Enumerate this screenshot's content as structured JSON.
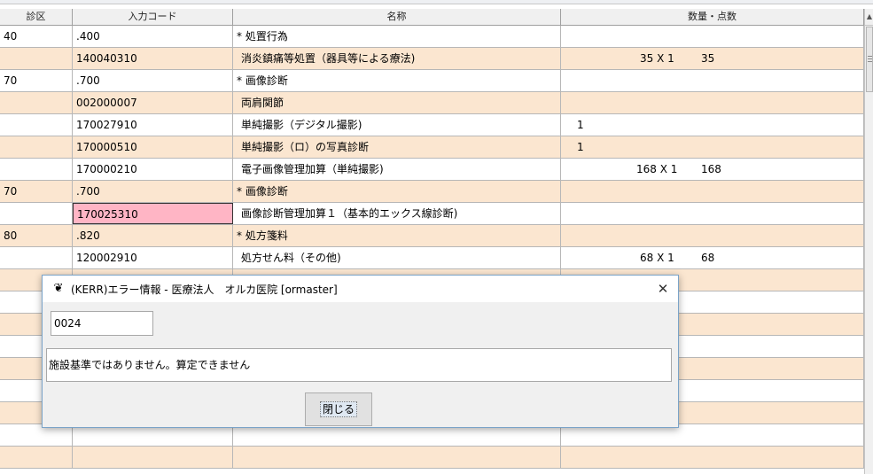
{
  "table": {
    "headers": [
      "診区",
      "入力コード",
      "名称",
      "数量・点数"
    ],
    "rows": [
      {
        "kubun": "40",
        "code": ".400",
        "name": "* 処置行為",
        "qty": "",
        "points": ""
      },
      {
        "kubun": "",
        "code": "140040310",
        "name": "消炎鎮痛等処置（器具等による療法)",
        "qty": "35 X 1",
        "points": "35"
      },
      {
        "kubun": "70",
        "code": ".700",
        "name": "* 画像診断",
        "qty": "",
        "points": ""
      },
      {
        "kubun": "",
        "code": "002000007",
        "name": "両肩関節",
        "qty": "",
        "points": ""
      },
      {
        "kubun": "",
        "code": "170027910",
        "name": "単純撮影（デジタル撮影)",
        "qty": "1",
        "points": ""
      },
      {
        "kubun": "",
        "code": "170000510",
        "name": "単純撮影（ロ）の写真診断",
        "qty": "1",
        "points": ""
      },
      {
        "kubun": "",
        "code": "170000210",
        "name": "電子画像管理加算（単純撮影)",
        "qty": "168 X 1",
        "points": "168"
      },
      {
        "kubun": "70",
        "code": ".700",
        "name": "* 画像診断",
        "qty": "",
        "points": ""
      },
      {
        "kubun": "",
        "code": "170025310",
        "name": "画像診断管理加算１（基本的エックス線診断)",
        "qty": "",
        "points": ""
      },
      {
        "kubun": "80",
        "code": ".820",
        "name": "* 処方箋料",
        "qty": "",
        "points": ""
      },
      {
        "kubun": "",
        "code": "120002910",
        "name": "処方せん料（その他)",
        "qty": "68 X 1",
        "points": "68"
      }
    ]
  },
  "dialog": {
    "title": "(KERR)エラー情報 - 医療法人　オルカ医院 [ormaster]",
    "code": "0024",
    "message": "施設基準ではありません。算定できません",
    "close_button": "閉じる",
    "close_icon": "close-icon",
    "app_icon": "orca-icon"
  },
  "colors": {
    "alt_row": "#fbe6d0",
    "selected_cell": "#ffb5c5"
  }
}
